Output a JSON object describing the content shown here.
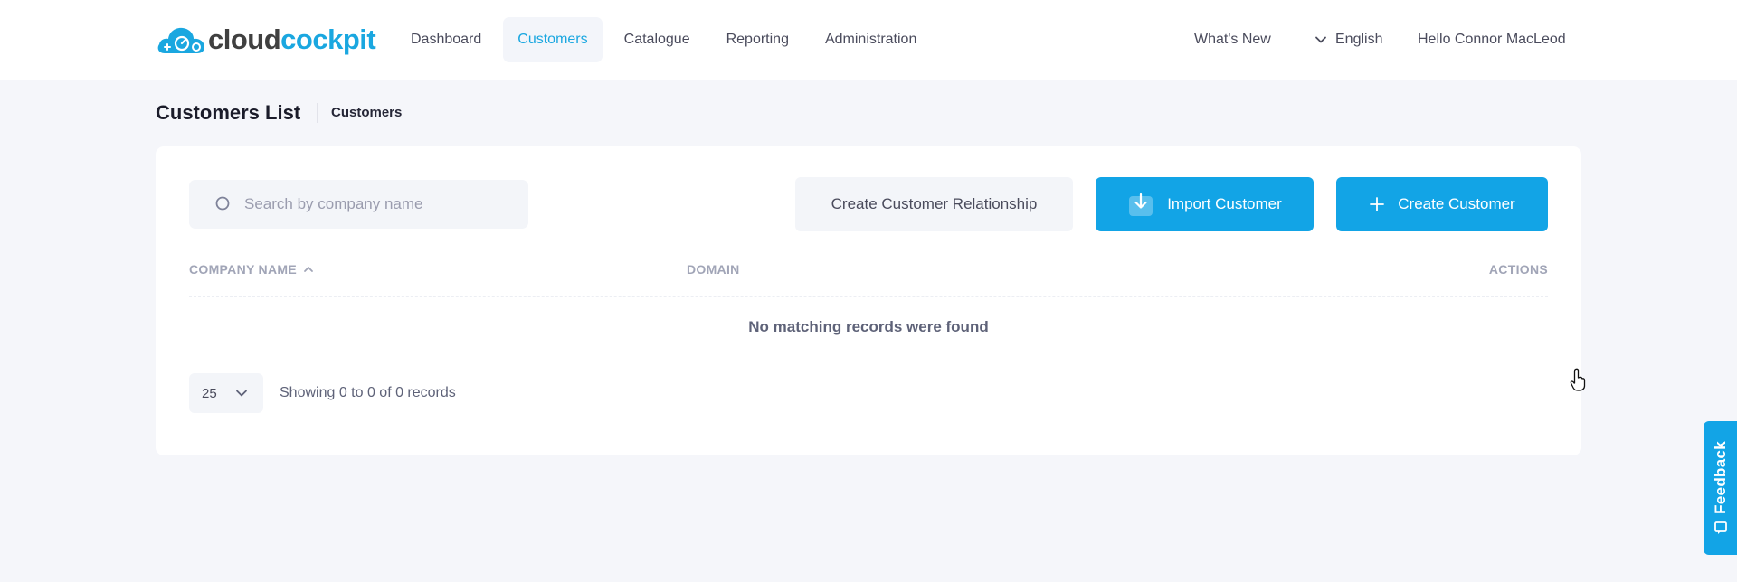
{
  "brand": {
    "name_part1": "cloud",
    "name_part2": "cockpit",
    "accent": "#1aa7e0"
  },
  "nav": {
    "items": [
      {
        "label": "Dashboard"
      },
      {
        "label": "Customers",
        "active": true
      },
      {
        "label": "Catalogue"
      },
      {
        "label": "Reporting"
      },
      {
        "label": "Administration"
      }
    ]
  },
  "header_right": {
    "whats_new": "What's New",
    "language": "English",
    "greeting": "Hello Connor MacLeod"
  },
  "page": {
    "title": "Customers List",
    "breadcrumb": "Customers"
  },
  "toolbar": {
    "search_placeholder": "Search by company name",
    "search_value": "",
    "create_relationship_label": "Create Customer Relationship",
    "import_label": "Import Customer",
    "create_label": "Create Customer",
    "primary_color": "#12a4e6"
  },
  "table": {
    "columns": [
      {
        "label": "COMPANY NAME",
        "sorted": "ascending"
      },
      {
        "label": "DOMAIN"
      },
      {
        "label": "ACTIONS"
      }
    ],
    "rows": [],
    "empty_message": "No matching records were found"
  },
  "pagination": {
    "page_size": "25",
    "info": "Showing 0 to 0 of 0 records"
  },
  "feedback": {
    "label": "Feedback"
  },
  "icons": [
    "cloud-logo-icon",
    "chevron-down-icon",
    "search-icon",
    "import-icon",
    "plus-icon",
    "sort-asc-icon",
    "feedback-icon",
    "hand-cursor-icon"
  ]
}
